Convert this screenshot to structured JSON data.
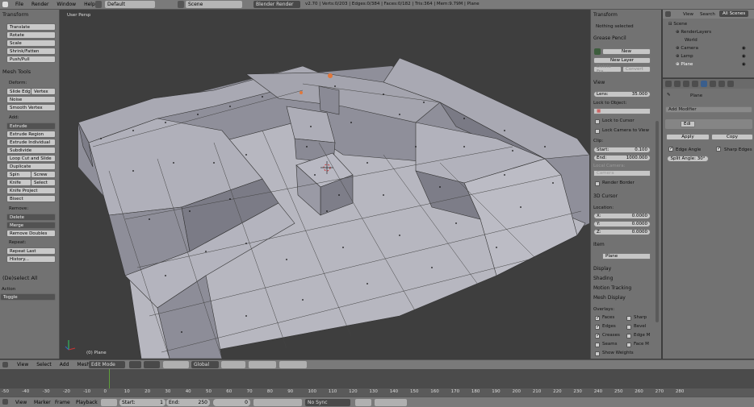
{
  "topbar": {
    "menus": [
      "File",
      "Render",
      "Window",
      "Help"
    ],
    "screen": "Default",
    "scene": "Scene",
    "engine": "Blender Render",
    "stats": "v2.70 | Verts:0/203 | Edges:0/384 | Faces:0/182 | Tris:364 | Mem:9.79M | Plane"
  },
  "left": {
    "transform_hdr": "Transform",
    "transform_btns": [
      "Translate",
      "Rotate",
      "Scale",
      "Shrink/Fatten",
      "Push/Pull"
    ],
    "meshtools_hdr": "Mesh Tools",
    "deform_lbl": "Deform:",
    "slide_edge": "Slide Edg",
    "vertex": "Vertex",
    "noise": "Noise",
    "smooth_vertex": "Smooth Vertex",
    "add_lbl": "Add:",
    "extrude": "Extrude",
    "extrude_region": "Extrude Region",
    "extrude_individual": "Extrude Individual",
    "subdivide": "Subdivide",
    "loopcut": "Loop Cut and Slide",
    "duplicate": "Duplicate",
    "spin": "Spin",
    "screw": "Screw",
    "knife": "Knife",
    "select": "Select",
    "knife_project": "Knife Project",
    "bisect": "Bisect",
    "remove_lbl": "Remove:",
    "delete": "Delete",
    "merge": "Merge",
    "remove_doubles": "Remove Doubles",
    "repeat_lbl": "Repeat:",
    "repeat_last": "Repeat Last",
    "history": "History...",
    "deselect_hdr": "(De)select All",
    "action_lbl": "Action",
    "action_val": "Toggle"
  },
  "viewport": {
    "label": "User Persp",
    "object": "(0) Plane"
  },
  "props": {
    "transform_hdr": "Transform",
    "nothing_selected": "Nothing selected",
    "grease_hdr": "Grease Pencil",
    "new": "New",
    "new_layer": "New Layer",
    "delete_frame": "Delete Fra...",
    "convert": "Convert",
    "view_hdr": "View",
    "lens_lbl": "Lens:",
    "lens_val": "35.000",
    "lock_object": "Lock to Object:",
    "lock_cursor": "Lock to Cursor",
    "lock_camera": "Lock Camera to View",
    "clip_lbl": "Clip:",
    "start_lbl": "Start:",
    "start_val": "0.100",
    "end_lbl": "End:",
    "end_val": "1000.000",
    "local_camera": "Local Camera:",
    "camera": "Camera",
    "render_border": "Render Border",
    "cursor_hdr": "3D Cursor",
    "location_lbl": "Location:",
    "x_lbl": "X:",
    "x_val": "0.0000",
    "y_lbl": "Y:",
    "y_val": "0.0000",
    "z_lbl": "Z:",
    "z_val": "0.0000",
    "item_hdr": "Item",
    "item_name": "Plane",
    "display_hdr": "Display",
    "shading_hdr": "Shading",
    "motion_hdr": "Motion Tracking",
    "meshdisplay_hdr": "Mesh Display",
    "overlays_lbl": "Overlays:",
    "faces": "Faces",
    "sharp": "Sharp",
    "edges": "Edges",
    "bevel": "Bevel",
    "creases": "Creases",
    "edge_m": "Edge M",
    "seams": "Seams",
    "face_m": "Face M",
    "show_weights": "Show Weights"
  },
  "outliner": {
    "view": "View",
    "search": "Search",
    "all_scenes": "All Scenes",
    "items": [
      "Scene",
      "RenderLayers",
      "World",
      "Camera",
      "Lamp",
      "Plane"
    ]
  },
  "modifiers": {
    "object": "Plane",
    "add_modifier": "Add Modifier",
    "edit": "Edi",
    "apply": "Apply",
    "copy": "Copy",
    "edge_angle": "Edge Angle",
    "sharp_edges": "Sharp Edges",
    "split_angle": "Split Angle: 30°"
  },
  "viewheader": {
    "menus": [
      "View",
      "Select",
      "Add",
      "Mesh"
    ],
    "mode": "Edit Mode",
    "orientation": "Global"
  },
  "timeline": {
    "ticks": [
      "-50",
      "-40",
      "-30",
      "-20",
      "-10",
      "0",
      "10",
      "20",
      "30",
      "40",
      "50",
      "60",
      "70",
      "80",
      "90",
      "100",
      "110",
      "120",
      "130",
      "140",
      "150",
      "160",
      "170",
      "180",
      "190",
      "200",
      "210",
      "220",
      "230",
      "240",
      "250",
      "260",
      "270",
      "280"
    ],
    "menus": [
      "View",
      "Marker",
      "Frame",
      "Playback"
    ],
    "start_lbl": "Start:",
    "start_val": "1",
    "end_lbl": "End:",
    "end_val": "250",
    "current": "0",
    "sync": "No Sync"
  }
}
